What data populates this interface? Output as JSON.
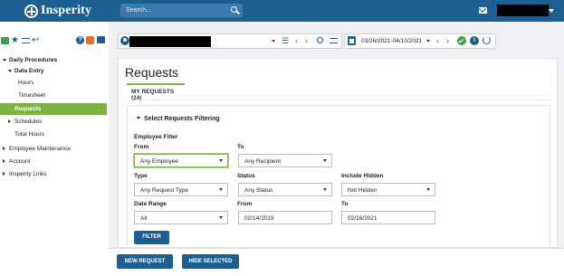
{
  "header": {
    "brand": "Insperity",
    "search_placeholder": "Search..."
  },
  "sidebar": {
    "items": [
      {
        "label": "Daily Procedures"
      },
      {
        "label": "Data Entry"
      },
      {
        "label": "Hours"
      },
      {
        "label": "Timesheet"
      },
      {
        "label": "Requests"
      },
      {
        "label": "Schedules"
      },
      {
        "label": "Total Hours"
      },
      {
        "label": "Employee Maintenance"
      },
      {
        "label": "Account"
      },
      {
        "label": "Insperity Links"
      }
    ]
  },
  "toolbar": {
    "date_range": "03/26/2021-04/10/2021"
  },
  "page": {
    "title": "Requests",
    "tab_label": "MY REQUESTS (24)",
    "section_title": "Select Requests Filtering",
    "employee_filter_label": "Employee Filter"
  },
  "filters": {
    "from_label": "From",
    "from_value": "Any Employee",
    "to_label": "To",
    "to_value": "Any Recipient",
    "type_label": "Type",
    "type_value": "Any Request Type",
    "status_label": "Status",
    "status_value": "Any Status",
    "hidden_label": "Include Hidden",
    "hidden_value": "Not Hidden",
    "date_range_label": "Date Range",
    "date_range_value": "All",
    "date_from_label": "From",
    "date_from_value": "02/14/2019",
    "date_to_label": "To",
    "date_to_value": "02/16/2021",
    "filter_button": "FILTER"
  },
  "actions": {
    "new_request": "NEW REQUEST",
    "hide_selected": "HIDE SELECTED"
  },
  "colors": {
    "header_blue": "#1d5f90",
    "accent_green": "#7cb342"
  }
}
